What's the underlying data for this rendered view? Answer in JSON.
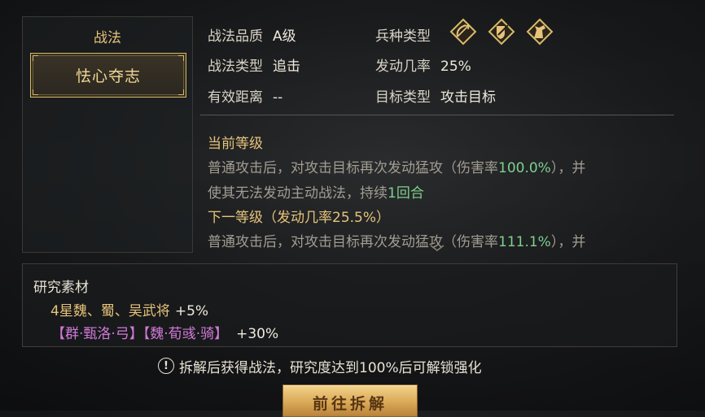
{
  "left_panel": {
    "title": "战法",
    "selected_skill": "怯心夺志"
  },
  "attributes": {
    "quality": {
      "label": "战法品质",
      "value": "A级"
    },
    "skill_type": {
      "label": "战法类型",
      "value": "追击"
    },
    "range": {
      "label": "有效距离",
      "value": "--"
    },
    "troop_type": {
      "label": "兵种类型",
      "icons": [
        "archer-troop-icon",
        "shield-troop-icon",
        "cavalry-troop-icon"
      ]
    },
    "trigger_rate": {
      "label": "发动几率",
      "value": "25%"
    },
    "target_type": {
      "label": "目标类型",
      "value": "攻击目标"
    }
  },
  "description": {
    "current_heading": "当前等级",
    "current_line1_a": "普通攻击后，对攻击目标再次发动猛攻（伤害率",
    "current_line1_rate": "100.0%",
    "current_line1_b": "），并",
    "current_line2_a": "使其无法发动主动战法，持续",
    "current_line2_turns": "1回合",
    "next_heading": "下一等级（发动几率25.5%）",
    "next_line1_a": "普通攻击后，对攻击目标再次发动猛攻（伤害率",
    "next_line1_rate": "111.1%",
    "next_line1_b": "），并"
  },
  "research": {
    "title": "研究素材",
    "material1": "4星魏、蜀、吴武将",
    "material1_bonus": "+5%",
    "material2": "【群·甄洛·弓】【魏·荀彧·骑】",
    "material2_bonus": "+30%"
  },
  "notice": {
    "text": "拆解后获得战法，研究度达到100%后可解锁强化"
  },
  "button": {
    "label": "前往拆解"
  },
  "colors": {
    "gold": "#e6c37a",
    "green": "#7fd08d",
    "purple": "#d07ad8",
    "gray_text": "#a39d92"
  }
}
